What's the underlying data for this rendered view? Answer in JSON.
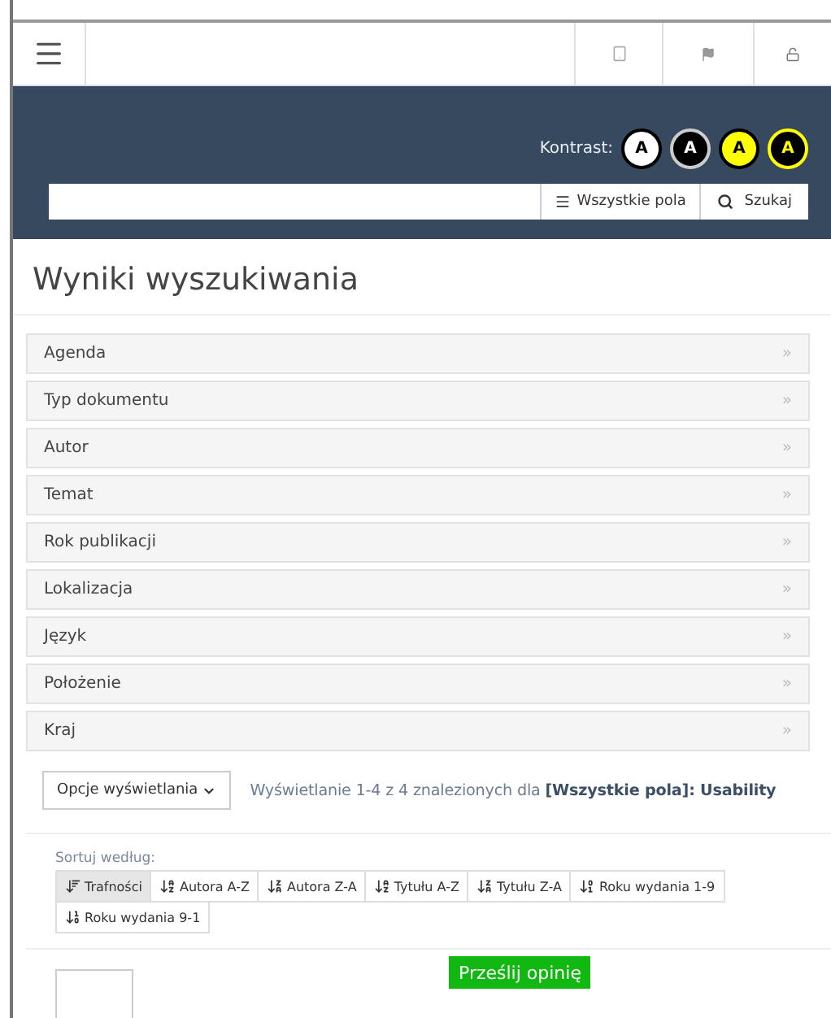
{
  "contrast": {
    "label": "Kontrast:",
    "options": [
      {
        "letter": "A",
        "kind": "white"
      },
      {
        "letter": "A",
        "kind": "black"
      },
      {
        "letter": "A",
        "kind": "yellow"
      },
      {
        "letter": "A",
        "kind": "black-yellow"
      }
    ]
  },
  "search": {
    "scope": "Wszystkie pola",
    "button": "Szukaj"
  },
  "title": "Wyniki wyszukiwania",
  "facets": [
    "Agenda",
    "Typ dokumentu",
    "Autor",
    "Temat",
    "Rok publikacji",
    "Lokalizacja",
    "Język",
    "Położenie",
    "Kraj"
  ],
  "facet_arrow": "»",
  "display_options": "Opcje wyświetlania",
  "summary": "Wyświetlanie 1-4 z 4 znalezionych dla **[Wszystkie pola]: Usability**",
  "sort": {
    "label": "Sortuj według:",
    "options": [
      {
        "label": "Trafności",
        "kind": "relevance",
        "selected": true
      },
      {
        "label": "Autora A-Z",
        "kind": "az",
        "selected": false
      },
      {
        "label": "Autora Z-A",
        "kind": "za",
        "selected": false
      },
      {
        "label": "Tytułu A-Z",
        "kind": "az",
        "selected": false
      },
      {
        "label": "Tytułu Z-A",
        "kind": "za",
        "selected": false
      },
      {
        "label": "Roku wydania 1-9",
        "kind": "num-up",
        "selected": false
      },
      {
        "label": "Roku wydania 9-1",
        "kind": "num-down",
        "selected": false
      }
    ]
  },
  "feedback": "Prześlij opinię"
}
